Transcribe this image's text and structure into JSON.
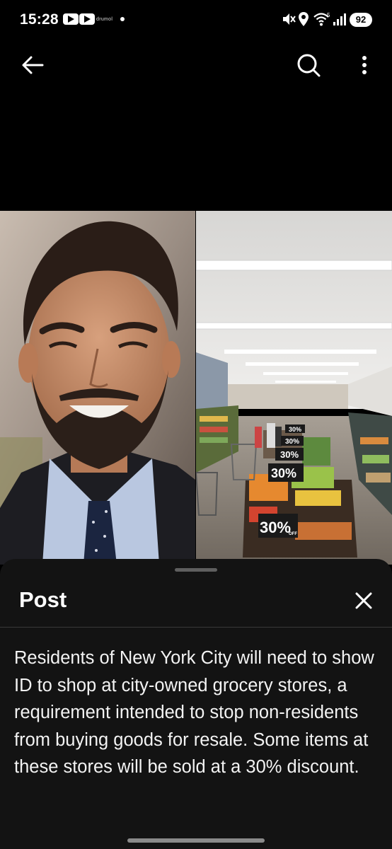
{
  "status_bar": {
    "time": "15:28",
    "notification_label": "drumol",
    "battery_level": "92",
    "icons": [
      "youtube-icon",
      "youtube-icon",
      "mute-icon",
      "location-icon",
      "wifi-icon",
      "signal-icon"
    ]
  },
  "top_nav": {
    "back_icon": "arrow-left-icon",
    "search_icon": "search-icon",
    "more_icon": "more-vertical-icon"
  },
  "media": {
    "left_image": "man-portrait-photo",
    "right_image": "grocery-store-photo",
    "store_signs": [
      "30%",
      "30%",
      "30%",
      "30%",
      "30%"
    ],
    "sign_sub_label": "OFF"
  },
  "sheet": {
    "title": "Post",
    "close_icon": "close-icon",
    "body": "Residents of New York City will need to show ID to shop at city-owned grocery stores, a requirement intended to stop non-residents from buying goods for resale.  Some items at these stores will be sold at a 30% discount."
  },
  "colors": {
    "background": "#000000",
    "sheet_background": "#131313",
    "text": "#f3f3f3"
  }
}
